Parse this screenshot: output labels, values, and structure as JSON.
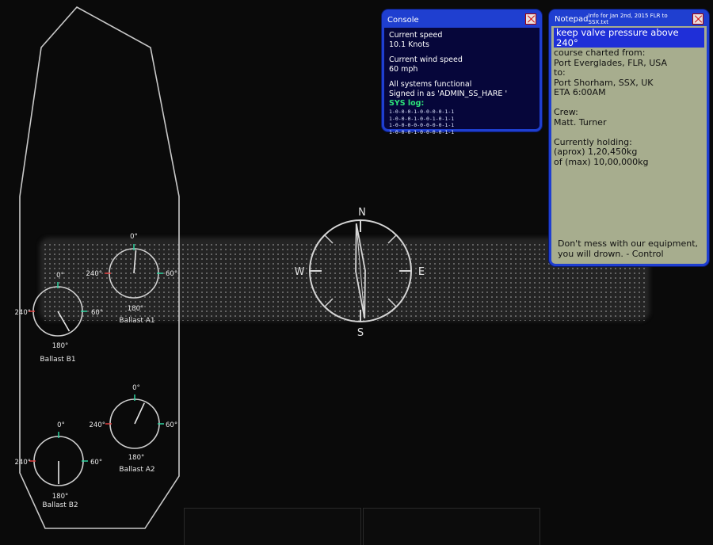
{
  "compass": {
    "north": "N",
    "south": "S",
    "east": "E",
    "west": "W",
    "heading_deg": 355
  },
  "gauges": [
    {
      "key": "a1",
      "name": "Ballast A1",
      "top": "0°",
      "right": "60°",
      "left": "240°",
      "bottom": "180°",
      "needle_deg": 5
    },
    {
      "key": "b1",
      "name": "Ballast B1",
      "top": "0°",
      "right": "60°",
      "left": "240°",
      "bottom": "180°",
      "needle_deg": 150
    },
    {
      "key": "a2",
      "name": "Ballast A2",
      "top": "0°",
      "right": "60°",
      "left": "240°",
      "bottom": "180°",
      "needle_deg": 25
    },
    {
      "key": "b2",
      "name": "Ballast B2",
      "top": "0°",
      "right": "60°",
      "left": "240°",
      "bottom": "180°",
      "needle_deg": 180
    }
  ],
  "console": {
    "title": "Console",
    "speed_label": "Current speed",
    "speed_value": "10.1 Knots",
    "wind_label": "Current wind speed",
    "wind_value": "60 mph",
    "status": "All systems functional",
    "signed_in": "Signed in as 'ADMIN_SS_HARE '",
    "log_label": "SYS log:",
    "log_lines": [
      "1-0-0-0-1-0-0-0-0-1-1",
      "1-0-0-0-1-0-0-1-0-1-1",
      "1-0-0-0-0-0-0-0-0-1-1",
      "1-0-0-0-1-0-0-0-0-1-1"
    ]
  },
  "notepad": {
    "title": "Notepad",
    "file": "Info for Jan 2nd, 2015 FLR to SSX.txt",
    "highlight": "keep valve pressure above 240°",
    "line_course": "course charted from:",
    "line_from": "Port Everglades, FLR, USA",
    "line_to": "to:",
    "line_dest": "Port Shorham, SSX, UK",
    "line_eta": "ETA 6:00AM",
    "line_crew": "Crew:",
    "line_crew_name": "Matt. Turner",
    "line_holding": "Currently holding:",
    "line_approx": "(aprox) 1,20,450kg",
    "line_max": "of (max) 10,00,000kg",
    "signoff_1": "Don't mess with our equipment,",
    "signoff_2": "you will drown. - Control"
  },
  "colors": {
    "window_border": "#1f3fd0",
    "console_bg": "#06063a",
    "notepad_bg": "#a7ad8e",
    "log_label": "#2de37a",
    "tick_green": "#2fd3a0",
    "tick_red": "#e04040"
  },
  "bottom_icons": [
    "satellite-icon",
    "gears-icon"
  ]
}
